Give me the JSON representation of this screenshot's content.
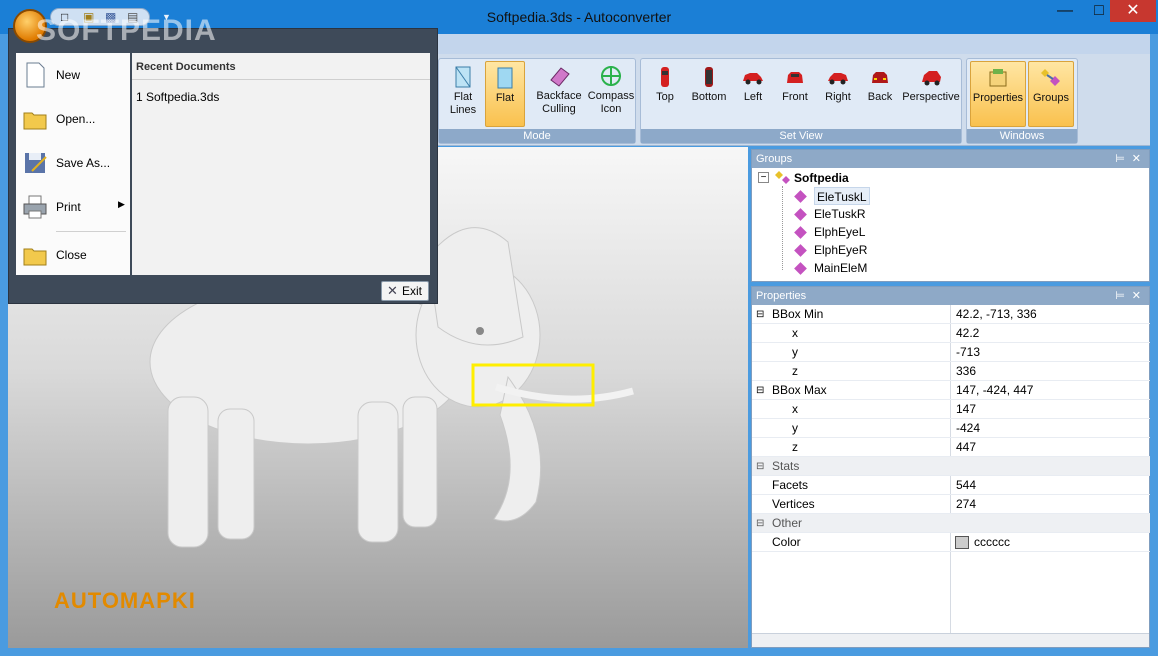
{
  "window": {
    "title": "Softpedia.3ds - Autoconverter",
    "watermark": "SOFTPEDIA"
  },
  "ribbon": {
    "groups": "Groups",
    "flat_lines_l1": "Flat",
    "flat_lines_l2": "Lines",
    "flat": "Flat",
    "backface_l1": "Backface",
    "backface_l2": "Culling",
    "compass_l1": "Compass",
    "compass_l2": "Icon",
    "mode_label": "Mode",
    "setview_label": "Set View",
    "windows_label": "Windows",
    "top": "Top",
    "bottom": "Bottom",
    "left": "Left",
    "front": "Front",
    "right": "Right",
    "back": "Back",
    "perspective": "Perspective",
    "properties": "Properties"
  },
  "app_menu": {
    "new": "New",
    "open": "Open...",
    "save_as": "Save As...",
    "print": "Print",
    "close": "Close",
    "recent_header": "Recent Documents",
    "recent_item": "1 Softpedia.3ds",
    "exit": "Exit"
  },
  "viewport": {
    "brand_text": "AUTOMAPKI"
  },
  "groups_panel": {
    "title": "Groups",
    "root": "Softpedia",
    "items": [
      "EleTuskL",
      "EleTuskR",
      "ElphEyeL",
      "ElphEyeR",
      "MainEleM"
    ]
  },
  "properties_panel": {
    "title": "Properties",
    "rows": [
      {
        "name": "BBox Min",
        "value": "42.2, -713, 336"
      },
      {
        "name": "x",
        "value": "42.2"
      },
      {
        "name": "y",
        "value": "-713"
      },
      {
        "name": "z",
        "value": "336"
      },
      {
        "name": "BBox Max",
        "value": "147, -424, 447"
      },
      {
        "name": "x",
        "value": "147"
      },
      {
        "name": "y",
        "value": "-424"
      },
      {
        "name": "z",
        "value": "447"
      },
      {
        "name": "Stats",
        "value": ""
      },
      {
        "name": "Facets",
        "value": "544"
      },
      {
        "name": "Vertices",
        "value": "274"
      },
      {
        "name": "Other",
        "value": ""
      },
      {
        "name": "Color",
        "value": "cccccc"
      }
    ],
    "color_swatch": "#cccccc"
  },
  "colors": {
    "accent": "#1b7fd6",
    "brand": "#e28a00",
    "highlight": "#f9c14e"
  }
}
